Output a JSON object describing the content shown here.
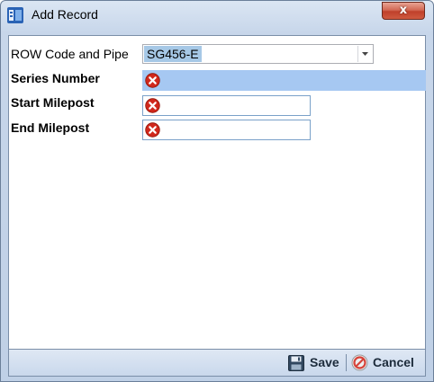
{
  "window": {
    "title": "Add Record",
    "close_label": "x"
  },
  "form": {
    "row_code": {
      "label": "ROW Code and Pipe",
      "value": "SG456-E"
    },
    "series_number": {
      "label": "Series Number",
      "value": ""
    },
    "start_milepost": {
      "label": "Start Milepost",
      "value": ""
    },
    "end_milepost": {
      "label": "End Milepost",
      "value": ""
    }
  },
  "actions": {
    "save_label": "Save",
    "separator": "|",
    "cancel_label": "Cancel"
  },
  "icons": {
    "app": "form-app-icon",
    "error": "error-x-icon",
    "save": "floppy-disk-icon",
    "cancel": "cancel-circle-icon",
    "dropdown": "chevron-down-icon"
  },
  "colors": {
    "accent_selection": "#a6c8e6",
    "error_red": "#d0281c",
    "titlebar": "#c7d6ea"
  }
}
